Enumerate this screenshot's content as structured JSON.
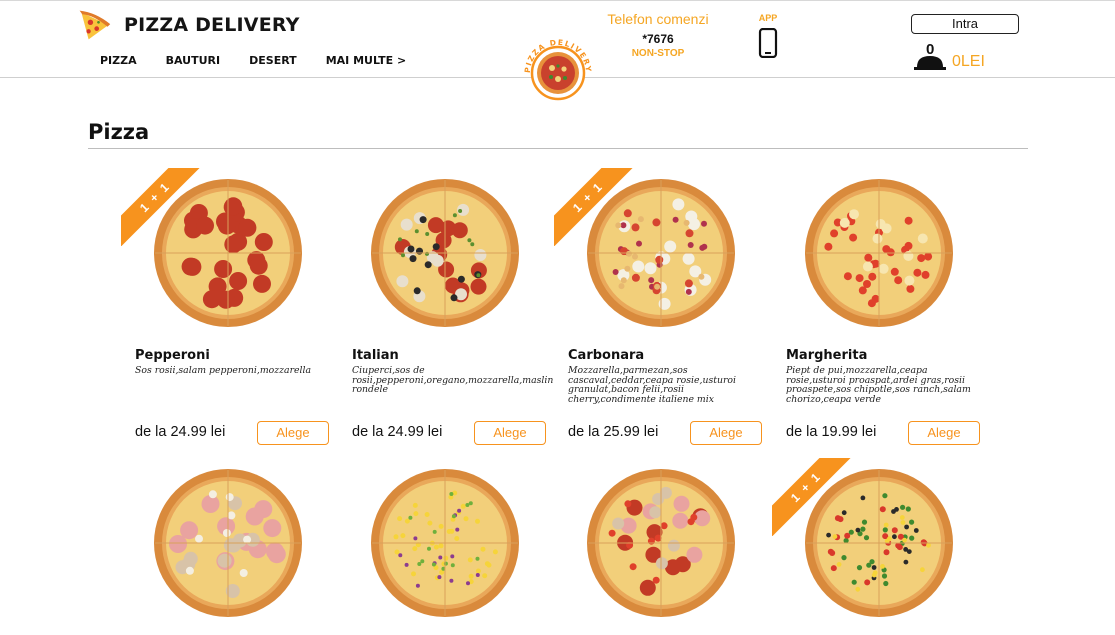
{
  "header": {
    "brand": "PIZZA DELIVERY",
    "badge_text": "PIZZA DELIVERY",
    "nav": [
      "PIZZA",
      "BAUTURI",
      "DESERT",
      "MAI MULTE >"
    ],
    "phone_title": "Telefon comenzi",
    "phone_number": "*7676",
    "phone_sub": "NON-STOP",
    "app_label": "APP",
    "login_label": "Intra",
    "cart_count": "0",
    "cart_total": "0LEI"
  },
  "section": {
    "title": "Pizza"
  },
  "colors": {
    "accent": "#f7931e",
    "accent_text": "#f5a623"
  },
  "products": [
    {
      "name": "Pepperoni",
      "desc": "Sos rosii,salam pepperoni,mozzarella",
      "price": "de la 24.99 lei",
      "button": "Alege",
      "ribbon": "1 + 1",
      "topping": "pepperoni"
    },
    {
      "name": "Italian",
      "desc": "Ciuperci,sos de rosii,pepperoni,oregano,mozzarella,maslin rondele",
      "price": "de la 24.99 lei",
      "button": "Alege",
      "ribbon": "",
      "topping": "italian"
    },
    {
      "name": "Carbonara",
      "desc": "Mozzarella,parmezan,sos cascaval,ceddar,ceapa rosie,usturoi granulat,bacon felii,rosii cherry,condimente italiene mix",
      "price": "de la 25.99 lei",
      "button": "Alege",
      "ribbon": "1 + 1",
      "topping": "carbonara"
    },
    {
      "name": "Margherita",
      "desc": "Piept de pui,mozzarella,ceapa rosie,usturoi proaspat,ardei gras,rosii proaspete,sos chipotle,sos ranch,salam chorizo,ceapa verde",
      "price": "de la 19.99 lei",
      "button": "Alege",
      "ribbon": "",
      "topping": "margherita"
    },
    {
      "name": "",
      "desc": "",
      "price": "",
      "button": "",
      "ribbon": "",
      "topping": "ham"
    },
    {
      "name": "",
      "desc": "",
      "price": "",
      "button": "",
      "ribbon": "",
      "topping": "corn"
    },
    {
      "name": "",
      "desc": "",
      "price": "",
      "button": "",
      "ribbon": "",
      "topping": "mix"
    },
    {
      "name": "",
      "desc": "",
      "price": "",
      "button": "",
      "ribbon": "1 + 1",
      "topping": "veggie"
    }
  ]
}
